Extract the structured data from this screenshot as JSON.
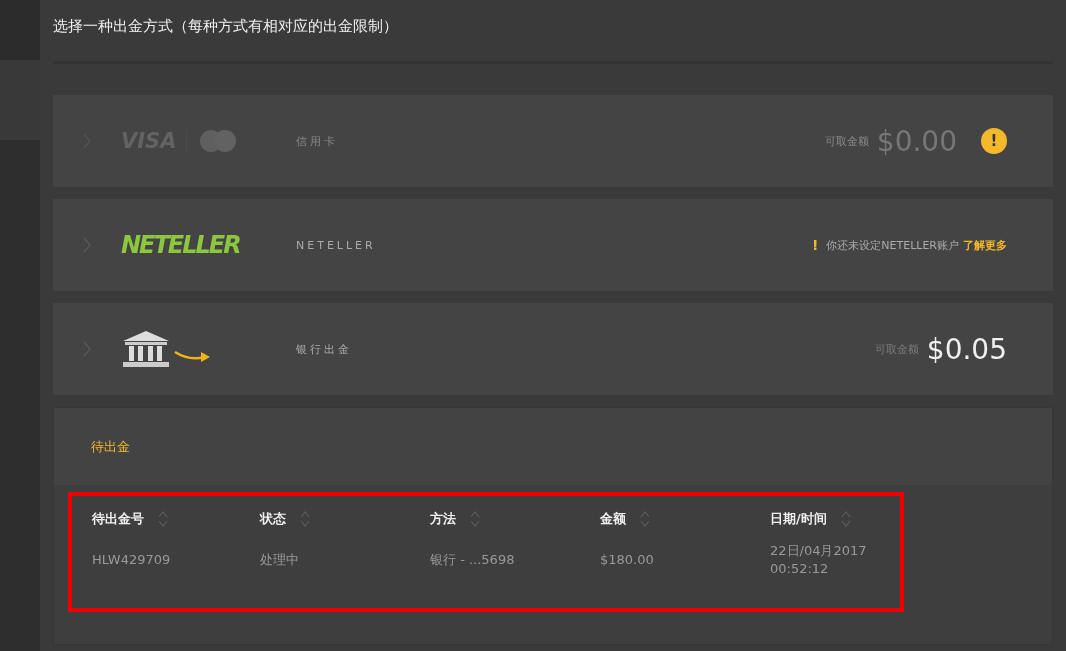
{
  "title": "选择一种出金方式（每种方式有相对应的出金限制）",
  "methods": [
    {
      "kind": "card",
      "disabled": true,
      "logo": "VISA",
      "label": "信用卡",
      "balance_label": "可取金额",
      "balance": "$0.00",
      "warning_badge": "!"
    },
    {
      "kind": "neteller",
      "disabled": false,
      "logo": "NETELLER",
      "label": "NETELLER",
      "notice_mark": "!",
      "notice": "你还未设定NETELLER账户",
      "link": "了解更多"
    },
    {
      "kind": "bank",
      "disabled": false,
      "label": "银行出金",
      "balance_label": "可取金额",
      "balance": "$0.05"
    }
  ],
  "pending": {
    "title": "待出金",
    "columns": [
      "待出金号",
      "状态",
      "方法",
      "金额",
      "日期/时间"
    ],
    "rows": [
      {
        "cells": [
          "HLW429709",
          "处理中",
          "银行 - ...5698",
          "$180.00",
          "22日/04月2017\n00:52:12"
        ]
      }
    ]
  }
}
